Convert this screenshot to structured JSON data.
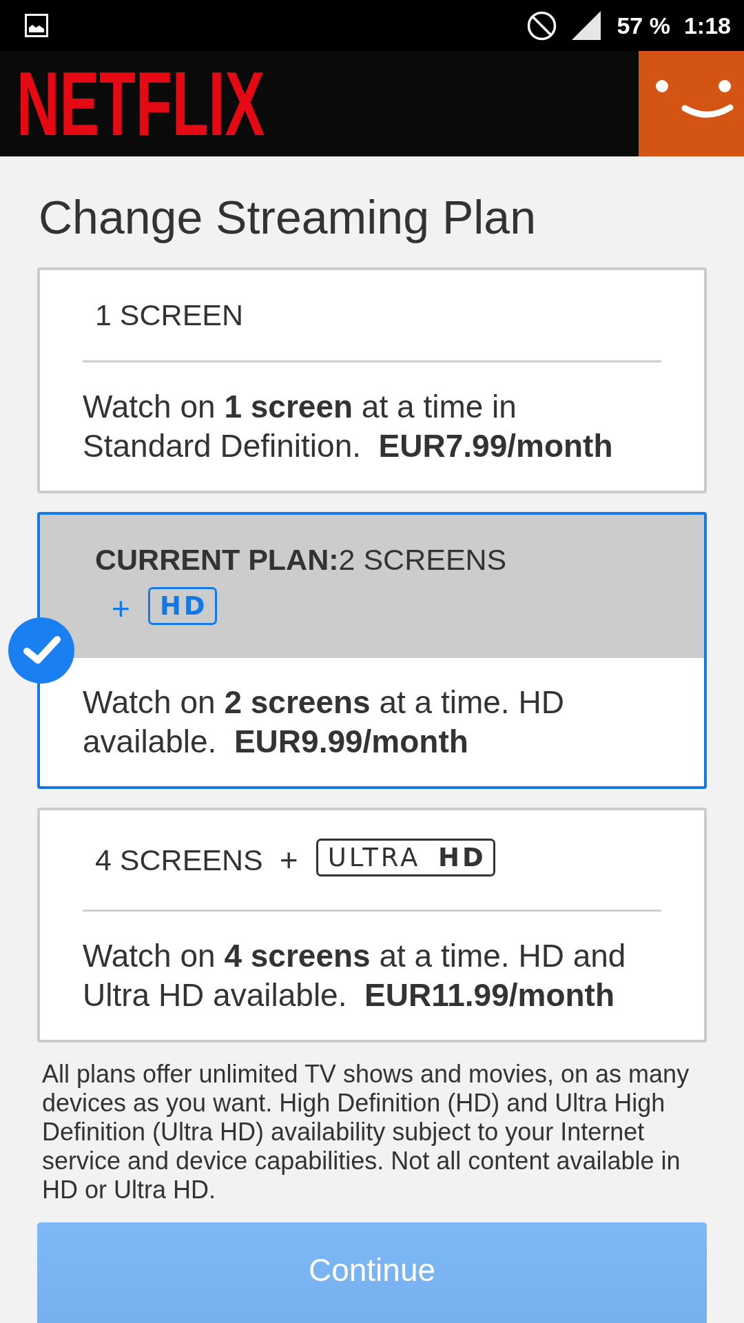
{
  "status_bar": {
    "battery": "57 %",
    "time": "1:18"
  },
  "header": {
    "logo": "NETFLIX"
  },
  "title": "Change Streaming Plan",
  "plans": [
    {
      "name": "1 SCREEN",
      "description": "Watch on **1 screen** at a time in Standard Definition.  **EUR7.99/month**",
      "selected": false
    },
    {
      "current_label": "CURRENT PLAN:",
      "name": "2 SCREENS",
      "plus": "+",
      "badge": {
        "kind": "hd",
        "text": "HD"
      },
      "description": "Watch on **2 screens** at a time. HD available.  **EUR9.99/month**",
      "selected": true
    },
    {
      "name": "4 SCREENS",
      "plus": "+",
      "badge": {
        "kind": "ultra_hd",
        "text": "ULTRA **HD**"
      },
      "description": "Watch on **4 screens** at a time. HD and Ultra HD available.  **EUR11.99/month**",
      "selected": false
    }
  ],
  "footnote": "All plans offer unlimited TV shows and movies, on as many devices as you want. High Definition (HD) and Ultra High Definition (Ultra HD) availability subject to your Internet service and device capabilities. Not all content available in HD or Ultra HD.",
  "continue_button": {
    "label": "Continue",
    "disabled": true
  }
}
